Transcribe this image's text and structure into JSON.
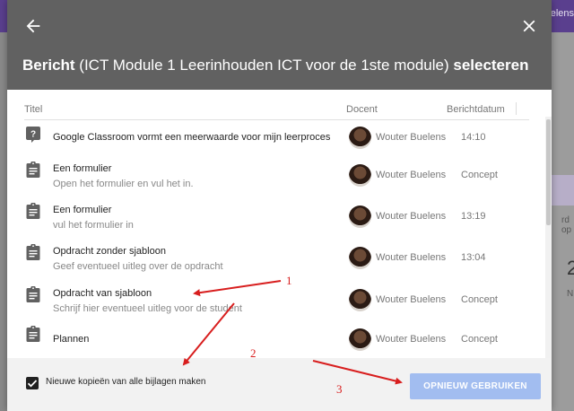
{
  "background": {
    "topbar_text": "elens",
    "side_text_1": "rd op",
    "side_text_2": "2",
    "side_text_3": "N"
  },
  "dialog": {
    "title_prefix": "Bericht",
    "title_middle": " (ICT Module 1 Leerinhouden ICT voor de 1ste module) ",
    "title_suffix": "selecteren",
    "columns": {
      "title": "Titel",
      "teacher": "Docent",
      "date": "Berichtdatum"
    },
    "rows": [
      {
        "icon": "question-icon",
        "title": "Google Classroom vormt een meerwaarde voor mijn leerproces",
        "subtitle": "",
        "teacher": "Wouter Buelens",
        "date": "14:10"
      },
      {
        "icon": "assignment-icon",
        "title": "Een formulier",
        "subtitle": "Open het formulier en vul het in.",
        "teacher": "Wouter Buelens",
        "date": "Concept"
      },
      {
        "icon": "assignment-icon",
        "title": "Een formulier",
        "subtitle": "vul het formulier in",
        "teacher": "Wouter Buelens",
        "date": "13:19"
      },
      {
        "icon": "assignment-icon",
        "title": "Opdracht zonder sjabloon",
        "subtitle": "Geef eventueel uitleg over de opdracht",
        "teacher": "Wouter Buelens",
        "date": "13:04"
      },
      {
        "icon": "assignment-icon",
        "title": "Opdracht van sjabloon",
        "subtitle": "Schrijf hier eventueel uitleg voor de student",
        "teacher": "Wouter Buelens",
        "date": "Concept"
      },
      {
        "icon": "assignment-icon",
        "title": "Plannen",
        "subtitle": "",
        "teacher": "Wouter Buelens",
        "date": "Concept"
      }
    ],
    "footer": {
      "checkbox_label": "Nieuwe kopieën van alle bijlagen maken",
      "checkbox_checked": true,
      "reuse_button": "OPNIEUW GEBRUIKEN"
    }
  },
  "annotations": {
    "one": "1",
    "two": "2",
    "three": "3",
    "color": "#d81e1e"
  },
  "colors": {
    "header": "#616161",
    "button": "#a2bdf0",
    "topbar": "#5a3f8e"
  }
}
